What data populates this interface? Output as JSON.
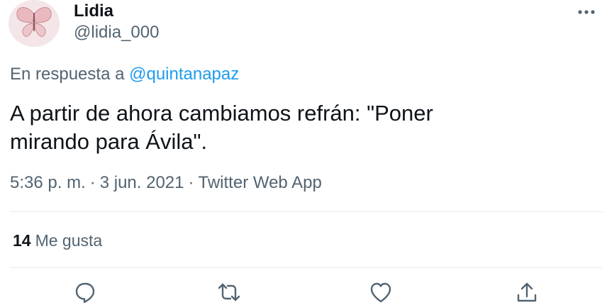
{
  "author": {
    "display_name": "Lidia",
    "handle": "@lidia_000",
    "avatar_icon": "butterfly-icon"
  },
  "menu": {
    "icon": "more-icon"
  },
  "reply": {
    "prefix": "En respuesta a",
    "mention": "@quintanapaz"
  },
  "tweet": {
    "text_line1": "A partir de ahora cambiamos refrán: \"Poner",
    "text_line2": "mirando para Ávila\"."
  },
  "meta": {
    "time": "5:36 p. m.",
    "separator": "·",
    "date": "3 jun. 2021",
    "separator2": "·",
    "source": "Twitter Web App"
  },
  "stats": {
    "likes_count": "14",
    "likes_label": "Me gusta"
  },
  "actions": {
    "reply_icon": "reply-icon",
    "retweet_icon": "retweet-icon",
    "like_icon": "heart-icon",
    "share_icon": "share-icon"
  },
  "colors": {
    "link": "#1d9bf0",
    "secondary_text": "#536471",
    "primary_text": "#0f1419",
    "divider": "#e6ecf0"
  }
}
